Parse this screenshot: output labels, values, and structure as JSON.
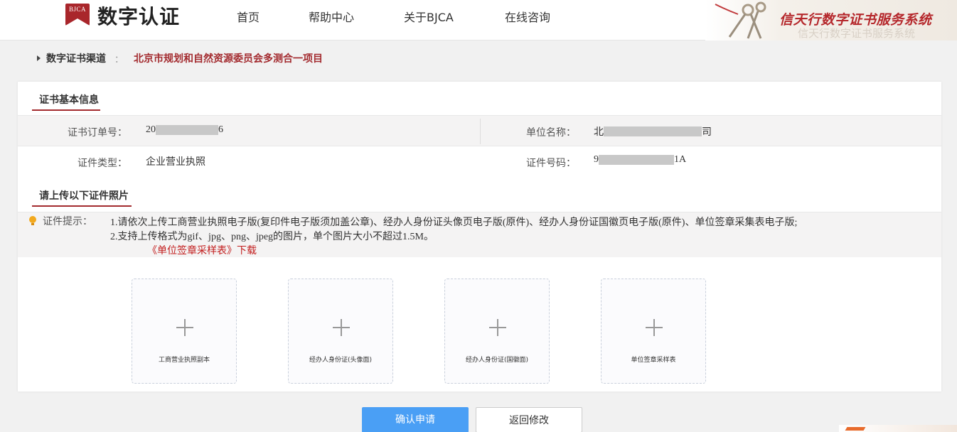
{
  "header": {
    "logo_badge": "BJCA",
    "logo_text": "数字认证",
    "nav": [
      "首页",
      "帮助中心",
      "关于BJCA",
      "在线咨询"
    ],
    "slogan": "信天行数字证书服务系统",
    "slogan_ghost": "信天行数字证书服务系统"
  },
  "breadcrumb": {
    "root": "数字证书渠道",
    "separator": "：",
    "current": "北京市规划和自然资源委员会多测合一项目"
  },
  "cert_info": {
    "section_title": "证书基本信息",
    "order_no_label": "证书订单号：",
    "order_no_prefix": "20",
    "order_no_suffix": "6",
    "org_name_label": "单位名称：",
    "org_name_prefix": "北",
    "org_name_suffix": "司",
    "cert_type_label": "证件类型：",
    "cert_type_value": "企业营业执照",
    "cert_no_label": "证件号码：",
    "cert_no_prefix": "9",
    "cert_no_suffix": "1A"
  },
  "upload_section": {
    "title": "请上传以下证件照片",
    "tip_label": "证件提示：",
    "tip_line1": "1.请依次上传工商营业执照电子版(复印件电子版须加盖公章)、经办人身份证头像页电子版(原件)、经办人身份证国徽页电子版(原件)、单位签章采集表电子版;",
    "tip_line2": "2.支持上传格式为gif、jpg、png、jpeg的图片，单个图片大小不超过1.5M。",
    "download_link": "《单位签章采样表》下载",
    "slots": [
      {
        "label": "工商营业执照副本"
      },
      {
        "label": "经办人身份证(头像面)"
      },
      {
        "label": "经办人身份证(国徽面)"
      },
      {
        "label": "单位签章采样表"
      }
    ]
  },
  "actions": {
    "confirm": "确认申请",
    "back": "返回修改"
  },
  "colors": {
    "brand_red": "#a32b2f",
    "primary_button": "#4a9ff5",
    "link_red": "#c21d1d"
  },
  "icons": [
    "play-triangle-icon",
    "lightbulb-icon",
    "plus-icon"
  ]
}
